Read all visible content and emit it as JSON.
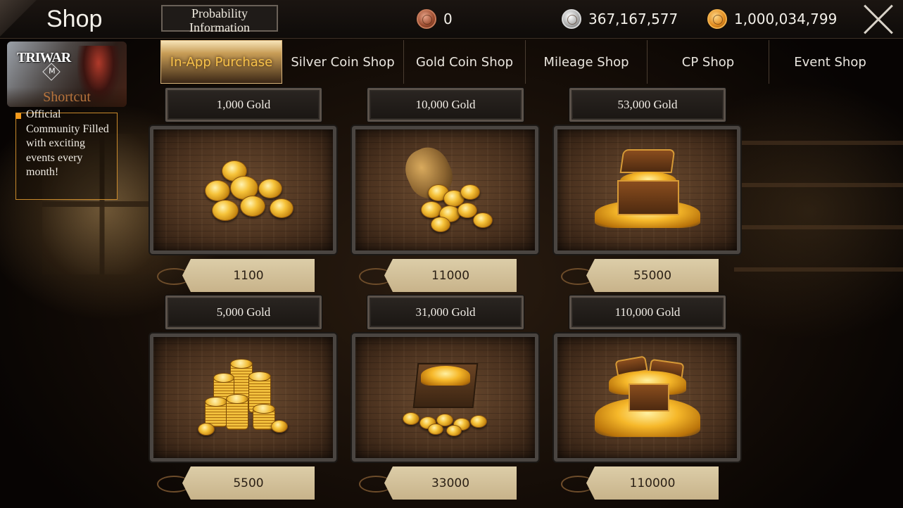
{
  "header": {
    "title": "Shop",
    "probability_button_line1": "Probability",
    "probability_button_line2": "Information",
    "currencies": {
      "bronze": "0",
      "silver": "367,167,577",
      "gold": "1,000,034,799"
    }
  },
  "shortcut": {
    "logo": "TRIWAR",
    "logo_mark": "M",
    "label": "Shortcut",
    "tooltip": "Official Community Filled with exciting events every month!"
  },
  "tabs": [
    {
      "label": "In-App Purchase",
      "active": true
    },
    {
      "label": "Silver Coin Shop",
      "active": false
    },
    {
      "label": "Gold Coin Shop",
      "active": false
    },
    {
      "label": "Mileage Shop",
      "active": false
    },
    {
      "label": "CP Shop",
      "active": false
    },
    {
      "label": "Event Shop",
      "active": false
    }
  ],
  "products": [
    {
      "name": "1,000 Gold",
      "price": "1100",
      "icon": "gold-coins-scattered-icon"
    },
    {
      "name": "10,000 Gold",
      "price": "11000",
      "icon": "gold-coin-bag-icon"
    },
    {
      "name": "53,000 Gold",
      "price": "55000",
      "icon": "gold-treasure-chest-icon"
    },
    {
      "name": "5,000 Gold",
      "price": "5500",
      "icon": "gold-coin-stacks-icon"
    },
    {
      "name": "31,000 Gold",
      "price": "33000",
      "icon": "gold-coin-crate-icon"
    },
    {
      "name": "110,000 Gold",
      "price": "110000",
      "icon": "gold-treasure-chests-icon"
    }
  ],
  "colors": {
    "accent_gold": "#f8c24a",
    "tooltip_border": "#c98a2c",
    "price_tag": "#d4c29c"
  }
}
